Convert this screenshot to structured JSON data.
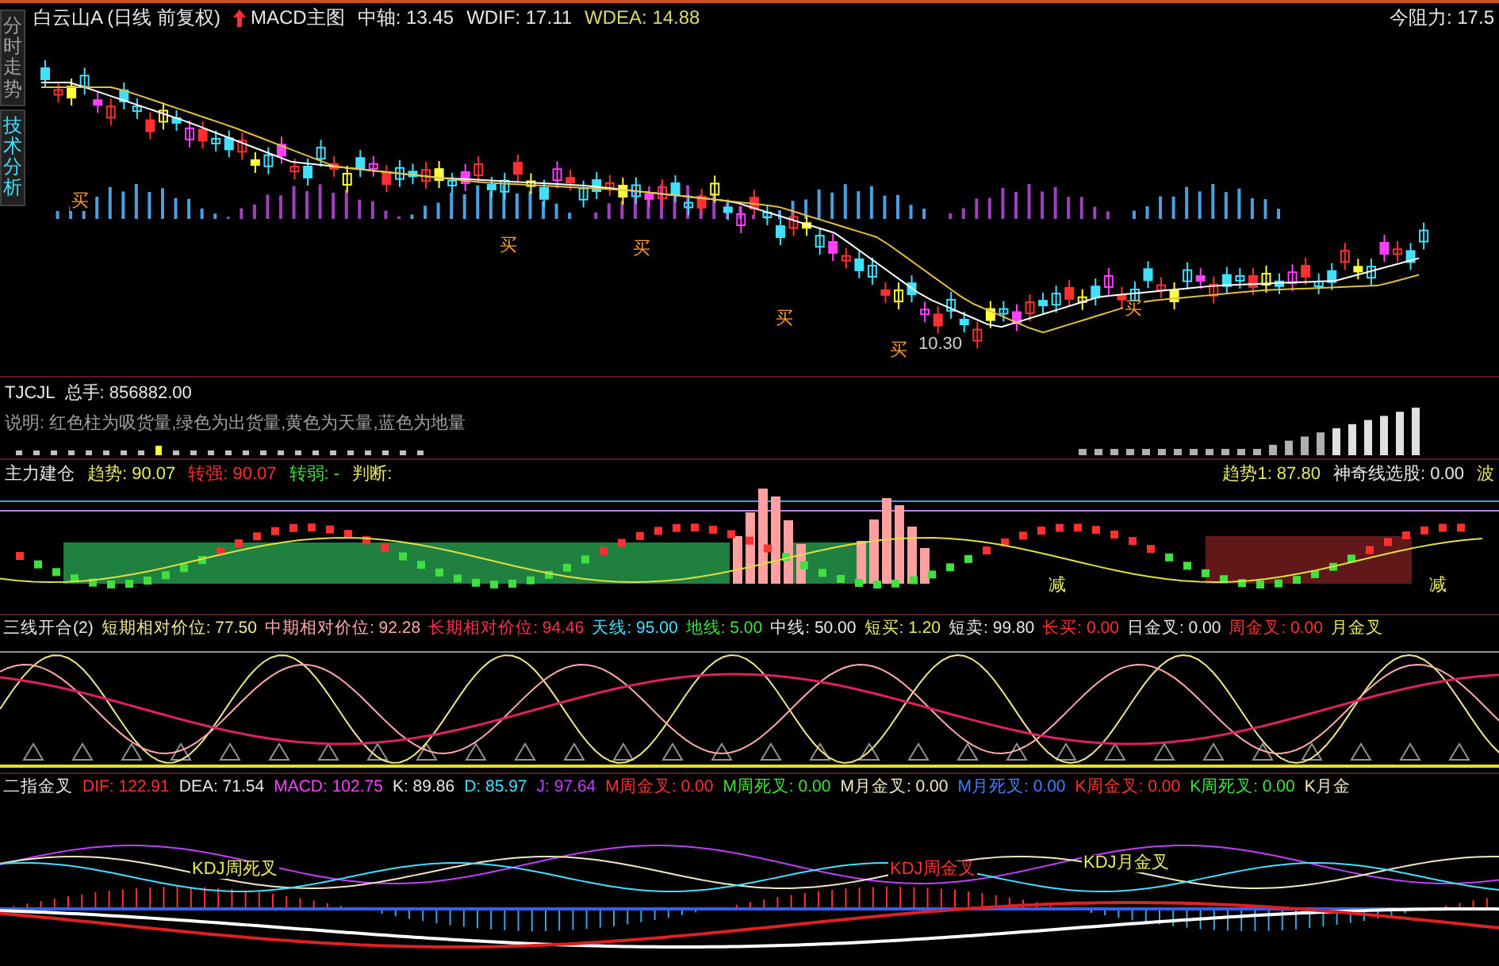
{
  "side_tabs": [
    {
      "label": "分时走势",
      "selected": false
    },
    {
      "label": "技术分析",
      "selected": true
    }
  ],
  "main_chart": {
    "title": "白云山A (日线 前复权)",
    "indicator": "MACD主图",
    "values": [
      {
        "text": "中轴: 13.45",
        "color": "#e8e8e8"
      },
      {
        "text": "WDIF: 17.11",
        "color": "#e8e8e8"
      },
      {
        "text": "WDEA: 14.88",
        "color": "#d8d870"
      }
    ],
    "resistance": "今阻力: 17.5",
    "marks": [
      {
        "text": "买",
        "color": "#ff9a30"
      },
      {
        "text": "买",
        "color": "#ff9a30"
      },
      {
        "text": "买",
        "color": "#ff9a30"
      },
      {
        "text": "买",
        "color": "#ff9a30"
      },
      {
        "text": "买",
        "color": "#ff9a30"
      },
      {
        "text": "买",
        "color": "#ff9a30"
      },
      {
        "text": "10.30",
        "color": "#d0d0d0"
      }
    ]
  },
  "volume_panel": {
    "title": "TJCJL",
    "values": [
      {
        "text": "总手: 856882.00",
        "color": "#e8e8e8"
      }
    ],
    "note": "说明: 红色柱为吸货量,绿色为出货量,黄色为天量,蓝色为地量"
  },
  "accumulation_panel": {
    "title": "主力建仓",
    "values": [
      {
        "text": "趋势: 90.07",
        "color": "#e8e860"
      },
      {
        "text": "转强: 90.07",
        "color": "#ff3030"
      },
      {
        "text": "转弱: -",
        "color": "#40e040"
      },
      {
        "text": "判断:",
        "color": "#e8e860"
      }
    ],
    "right_values": [
      {
        "text": "趋势1: 87.80",
        "color": "#e8e860"
      },
      {
        "text": "神奇线选股: 0.00",
        "color": "#e8e8e8"
      },
      {
        "text": "波",
        "color": "#e8e860"
      }
    ],
    "marks": [
      {
        "text": "减",
        "color": "#e8e860"
      },
      {
        "text": "减",
        "color": "#e8e860"
      }
    ]
  },
  "three_line_panel": {
    "title": "三线开合(2)",
    "values": [
      {
        "text": "短期相对价位: 77.50",
        "color": "#f0e68c"
      },
      {
        "text": "中期相对价位: 92.28",
        "color": "#ffaaaa"
      },
      {
        "text": "长期相对价位: 94.46",
        "color": "#ff3050"
      },
      {
        "text": "天线: 95.00",
        "color": "#40e0ff"
      },
      {
        "text": "地线: 5.00",
        "color": "#40e040"
      },
      {
        "text": "中线: 50.00",
        "color": "#e8e8e8"
      },
      {
        "text": "短买: 1.20",
        "color": "#e8e860"
      },
      {
        "text": "短卖: 99.80",
        "color": "#e8e8e8"
      },
      {
        "text": "长买: 0.00",
        "color": "#ff3030"
      },
      {
        "text": "日金叉: 0.00",
        "color": "#e8e8e8"
      },
      {
        "text": "周金叉: 0.00",
        "color": "#ff3030"
      },
      {
        "text": "月金叉",
        "color": "#e8e860"
      }
    ]
  },
  "cross_panel": {
    "title": "二指金叉",
    "values": [
      {
        "text": "DIF: 122.91",
        "color": "#ff3030"
      },
      {
        "text": "DEA: 71.54",
        "color": "#e8e8e8"
      },
      {
        "text": "MACD: 102.75",
        "color": "#ff40ff"
      },
      {
        "text": "K: 89.86",
        "color": "#e8e8e8"
      },
      {
        "text": "D: 85.97",
        "color": "#40e0ff"
      },
      {
        "text": "J: 97.64",
        "color": "#c040ff"
      },
      {
        "text": "M周金叉: 0.00",
        "color": "#ff3030"
      },
      {
        "text": "M周死叉: 0.00",
        "color": "#40e040"
      },
      {
        "text": "M月金叉: 0.00",
        "color": "#f0e8c0"
      },
      {
        "text": "M月死叉: 0.00",
        "color": "#4080ff"
      },
      {
        "text": "K周金叉: 0.00",
        "color": "#ff3030"
      },
      {
        "text": "K周死叉: 0.00",
        "color": "#40e040"
      },
      {
        "text": "K月金",
        "color": "#f0e8c0"
      }
    ],
    "marks": [
      {
        "text": "KDJ周死叉",
        "color": "#e8e860"
      },
      {
        "text": "KDJ周金叉",
        "color": "#ff3030"
      },
      {
        "text": "KDJ月金叉",
        "color": "#e8e860"
      }
    ]
  }
}
